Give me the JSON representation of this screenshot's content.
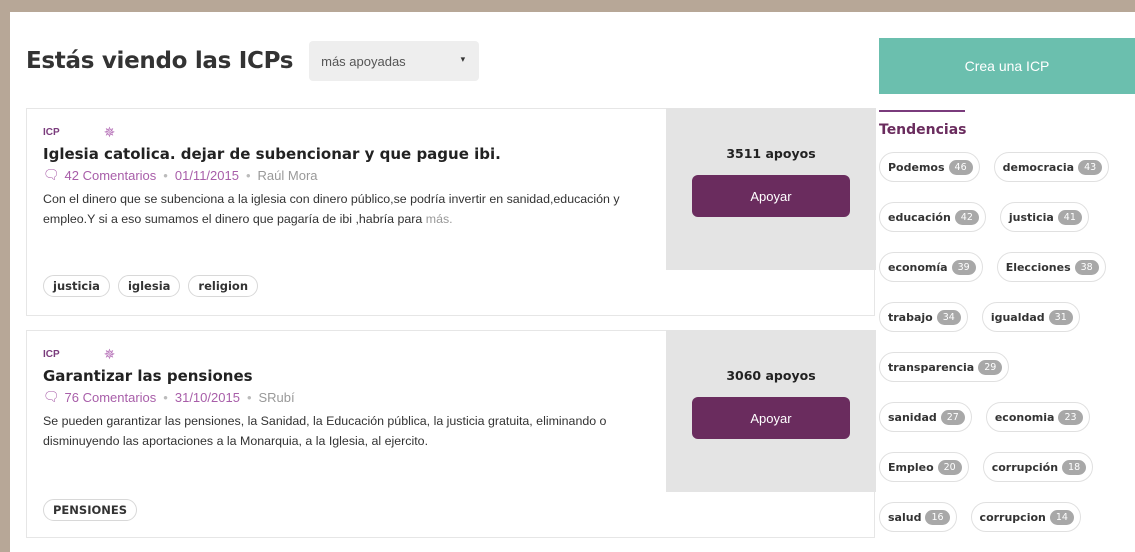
{
  "header": {
    "title": "Estás viendo las ICPs",
    "sort_selected": "más apoyadas"
  },
  "cards": [
    {
      "label": "ICP",
      "title": "Iglesia catolica. dejar de subencionar y que pague ibi.",
      "comments": "42 Comentarios",
      "date": "01/11/2015",
      "author": "Raúl Mora",
      "description": "Con el dinero que se subenciona a la iglesia con dinero público,se podría invertir en sanidad,educación y empleo.Y si a eso sumamos el dinero que pagaría de ibi ,habría para",
      "more": "más.",
      "tags": [
        "justicia",
        "iglesia",
        "religion"
      ],
      "supports": "3511 apoyos",
      "support_button": "Apoyar"
    },
    {
      "label": "ICP",
      "title": "Garantizar las pensiones",
      "comments": "76 Comentarios",
      "date": "31/10/2015",
      "author": "SRubí",
      "description": "Se pueden garantizar las pensiones, la Sanidad, la Educación pública, la justicia gratuita, eliminando o disminuyendo las aportaciones a la Monarquia, a la Iglesia, al ejercito.",
      "more": "",
      "tags": [
        "PENSIONES"
      ],
      "supports": "3060 apoyos",
      "support_button": "Apoyar"
    }
  ],
  "sidebar": {
    "create_button": "Crea una ICP",
    "trends_title": "Tendencias",
    "trends": [
      {
        "name": "Podemos",
        "count": "46"
      },
      {
        "name": "democracia",
        "count": "43"
      },
      {
        "name": "educación",
        "count": "42"
      },
      {
        "name": "justicia",
        "count": "41"
      },
      {
        "name": "economía",
        "count": "39"
      },
      {
        "name": "Elecciones",
        "count": "38"
      },
      {
        "name": "trabajo",
        "count": "34"
      },
      {
        "name": "igualdad",
        "count": "31"
      },
      {
        "name": "transparencia",
        "count": "29"
      },
      {
        "name": "sanidad",
        "count": "27"
      },
      {
        "name": "economia",
        "count": "23"
      },
      {
        "name": "Empleo",
        "count": "20"
      },
      {
        "name": "corrupción",
        "count": "18"
      },
      {
        "name": "salud",
        "count": "16"
      },
      {
        "name": "corrupcion",
        "count": "14"
      }
    ]
  },
  "colors": {
    "accent_purple": "#6a2c5e",
    "create_teal": "#6bbfae",
    "meta_purple": "#a85ea9"
  },
  "icons": {
    "bulb": "lightbulb-icon",
    "comment": "comment-icon",
    "caret": "chevron-down-icon"
  }
}
